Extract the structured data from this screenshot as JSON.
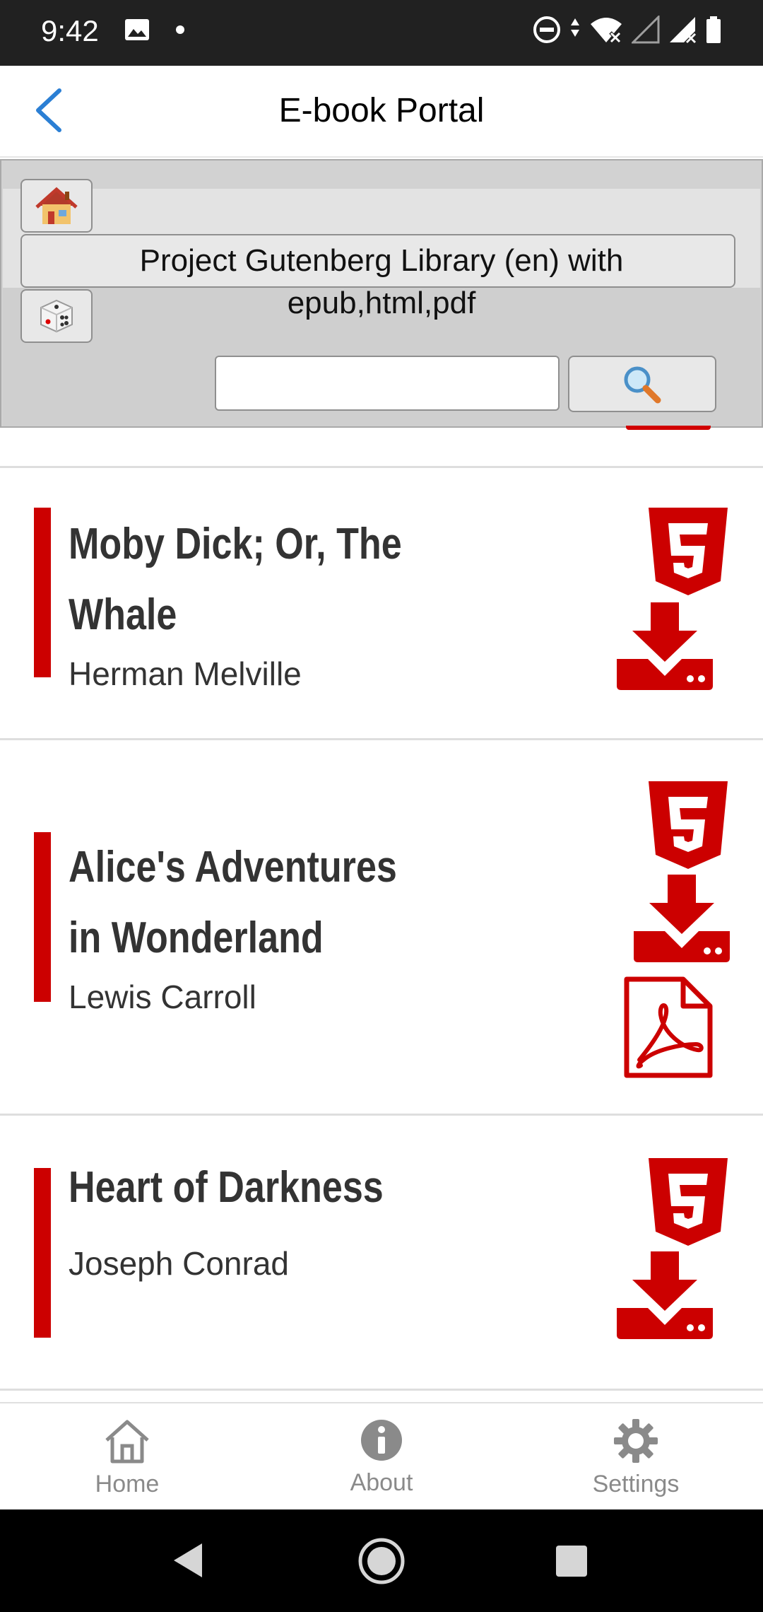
{
  "status_bar": {
    "time": "9:42",
    "icons": [
      "image-icon",
      "dot-icon",
      "do-not-disturb-icon",
      "data-arrows-icon",
      "wifi-off-icon",
      "signal-empty-icon",
      "signal-x-icon",
      "battery-icon"
    ]
  },
  "header": {
    "title": "E-book Portal",
    "back_icon": "chevron-left-icon"
  },
  "portal": {
    "home_emoji": "🏠",
    "library_label": "Project Gutenberg Library (en) with epub,html,pdf",
    "dice_emoji": "🎲",
    "search_placeholder": "",
    "search_emoji": "🔍"
  },
  "books": [
    {
      "title": "Moby Dick; Or, The Whale",
      "author": "Herman Melville",
      "formats": [
        "html5-icon",
        "download-icon"
      ]
    },
    {
      "title": "Alice's Adventures in Wonderland",
      "author": "Lewis Carroll",
      "formats": [
        "html5-icon",
        "download-icon",
        "pdf-icon"
      ]
    },
    {
      "title": "Heart of Darkness",
      "author": "Joseph Conrad",
      "formats": [
        "html5-icon",
        "download-icon"
      ]
    }
  ],
  "bottom_nav": {
    "items": [
      {
        "label": "Home",
        "icon": "home-icon"
      },
      {
        "label": "About",
        "icon": "info-icon"
      },
      {
        "label": "Settings",
        "icon": "gear-icon"
      }
    ]
  },
  "colors": {
    "accent_red": "#cc0000",
    "header_blue": "#2b7fd4",
    "nav_gray": "#8a8a8a"
  }
}
